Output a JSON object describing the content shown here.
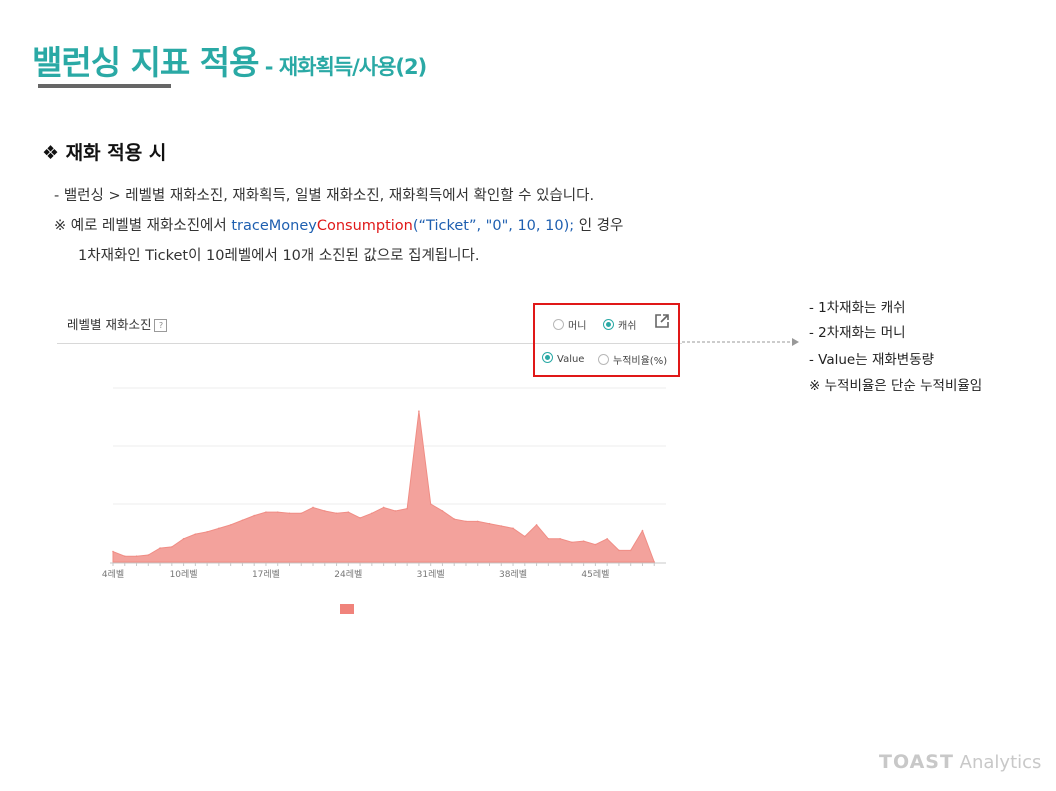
{
  "header": {
    "title_main": "밸런싱 지표 적용",
    "title_dash": " - ",
    "title_sub": "재화획득/사용(2)"
  },
  "section": {
    "bullet": "❖",
    "title": "재화 적용 시"
  },
  "body": {
    "line1": "- 밸런싱 > 레벨별 재화소진, 재화획득, 일별 재화소진, 재화획득에서 확인할 수 있습니다.",
    "line2_prefix": "※ 예로 레벨별 재화소진에서 ",
    "line2_code_a": "traceMoney",
    "line2_code_b": "Consumption",
    "line2_code_c": "(“Ticket”, \"0\", 10, 10);",
    "line2_suffix": " 인 경우",
    "line3": "1차재화인 Ticket이 10레벨에서 10개 소진된 값으로 집계됩니다."
  },
  "widget": {
    "title": "레벨별 재화소진",
    "help_icon": "?",
    "options": {
      "money": "머니",
      "cash": "캐쉬",
      "value": "Value",
      "cumulative": "누적비율(%)"
    },
    "selected_currency": "cash",
    "selected_mode": "value",
    "export_icon": "external-link-icon"
  },
  "notes": [
    "- 1차재화는 캐쉬",
    "- 2차재화는 머니",
    "- Value는 재화변동량",
    "※ 누적비율은 단순 누적비율임"
  ],
  "chart_data": {
    "type": "area",
    "x": [
      4,
      5,
      6,
      7,
      8,
      9,
      10,
      11,
      12,
      13,
      14,
      15,
      16,
      17,
      18,
      19,
      20,
      21,
      22,
      23,
      24,
      25,
      26,
      27,
      28,
      29,
      30,
      31,
      32,
      33,
      34,
      35,
      36,
      37,
      38,
      39,
      40,
      41,
      42,
      43,
      44,
      45,
      46,
      47,
      48,
      49,
      50
    ],
    "values": [
      0.09,
      0.05,
      0.05,
      0.06,
      0.12,
      0.13,
      0.2,
      0.24,
      0.26,
      0.29,
      0.32,
      0.36,
      0.4,
      0.43,
      0.43,
      0.42,
      0.42,
      0.47,
      0.44,
      0.42,
      0.43,
      0.38,
      0.42,
      0.47,
      0.44,
      0.46,
      1.3,
      0.5,
      0.44,
      0.37,
      0.35,
      0.35,
      0.33,
      0.31,
      0.29,
      0.22,
      0.32,
      0.2,
      0.2,
      0.17,
      0.18,
      0.15,
      0.2,
      0.1,
      0.1,
      0.27,
      0.0
    ],
    "tick_labels": [
      "4레벨",
      "10레벨",
      "17레벨",
      "24레벨",
      "31레벨",
      "38레벨",
      "45레벨"
    ],
    "tick_values": [
      4,
      10,
      17,
      24,
      31,
      38,
      45
    ],
    "xlim": [
      4,
      51
    ],
    "ylim": [
      0,
      1.5
    ],
    "grid": true,
    "legend": "bottom-center",
    "color": "#f3a29c",
    "legend_color": "#f0837b"
  }
}
